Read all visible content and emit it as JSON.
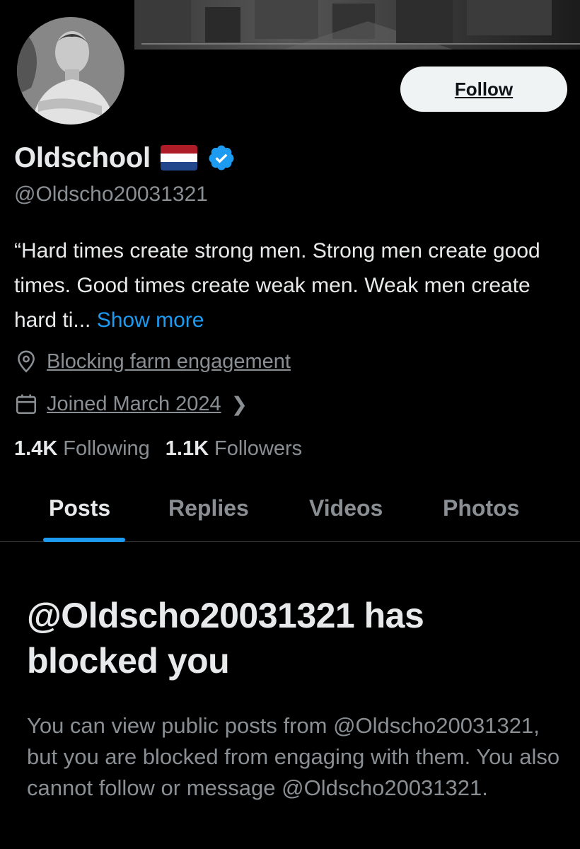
{
  "profile": {
    "display_name": "Oldschool",
    "handle": "@Oldscho20031321",
    "verified": true,
    "flag": "netherlands-flag",
    "bio": "“Hard times create strong men. Strong men create good times. Good times create weak men. Weak men create hard ti...",
    "show_more": "Show more",
    "location": "Blocking farm engagement",
    "joined": "Joined March 2024",
    "following_count": "1.4K",
    "following_label": "Following",
    "followers_count": "1.1K",
    "followers_label": "Followers"
  },
  "actions": {
    "follow_label": "Follow"
  },
  "tabs": [
    {
      "label": "Posts",
      "active": true
    },
    {
      "label": "Replies",
      "active": false
    },
    {
      "label": "Videos",
      "active": false
    },
    {
      "label": "Photos",
      "active": false
    }
  ],
  "blocked": {
    "title": "@Oldscho20031321 has blocked you",
    "description": "You can view public posts from @Oldscho20031321, but you are blocked from engaging with them. You also cannot follow or message @Oldscho20031321."
  },
  "colors": {
    "background": "#000000",
    "accent": "#1d9bf0",
    "text_primary": "#e7e9ea",
    "text_secondary": "#8a8f94",
    "follow_button_bg": "#eff3f4"
  },
  "icons": {
    "location": "location-pin-icon",
    "calendar": "calendar-icon",
    "verified": "verified-badge-icon",
    "chevron": "chevron-right-icon"
  }
}
